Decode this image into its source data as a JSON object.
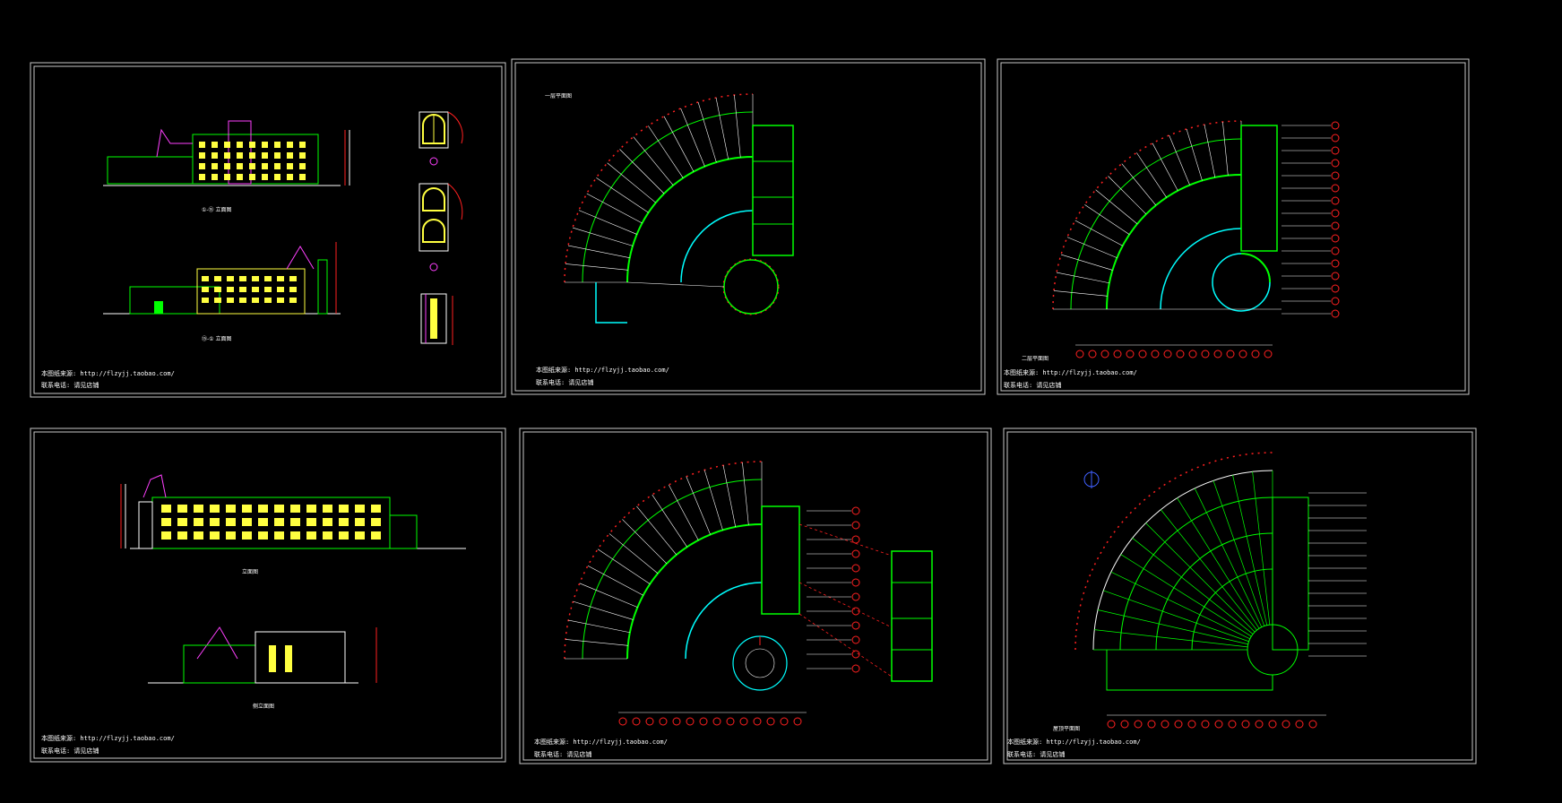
{
  "colors": {
    "background": "#000000",
    "frame": "#c8c8c8",
    "wall": "#00ff00",
    "wall_alt": "#00ffff",
    "dimension": "#ff2020",
    "grid": "#ffffff",
    "yellow": "#ffff40",
    "magenta": "#ff40ff",
    "blue": "#4060ff"
  },
  "sheets": [
    {
      "id": "sheet-1",
      "kind": "elevations",
      "captions": [
        "①-⑮ 立面图",
        "⑮-① 立面图"
      ],
      "notes": [
        "本图纸来源: http://flzyjj.taobao.com/",
        "联系电话: 请见店铺"
      ]
    },
    {
      "id": "sheet-2",
      "kind": "floor-plan",
      "captions": [
        "一层平面图"
      ],
      "notes": [
        "本图纸来源: http://flzyjj.taobao.com/",
        "联系电话: 请见店铺"
      ]
    },
    {
      "id": "sheet-3",
      "kind": "floor-plan",
      "captions": [
        "二层平面图"
      ],
      "notes": [
        "本图纸来源: http://flzyjj.taobao.com/",
        "联系电话: 请见店铺"
      ]
    },
    {
      "id": "sheet-4",
      "kind": "elevations",
      "captions": [
        "立面图",
        "侧立面图"
      ],
      "notes": [
        "本图纸来源: http://flzyjj.taobao.com/",
        "联系电话: 请见店铺"
      ]
    },
    {
      "id": "sheet-5",
      "kind": "floor-plan",
      "captions": [],
      "notes": [
        "本图纸来源: http://flzyjj.taobao.com/",
        "联系电话: 请见店铺"
      ]
    },
    {
      "id": "sheet-6",
      "kind": "roof-plan",
      "captions": [
        "屋顶平面图"
      ],
      "notes": [
        "本图纸来源: http://flzyjj.taobao.com/",
        "联系电话: 请见店铺"
      ]
    }
  ]
}
